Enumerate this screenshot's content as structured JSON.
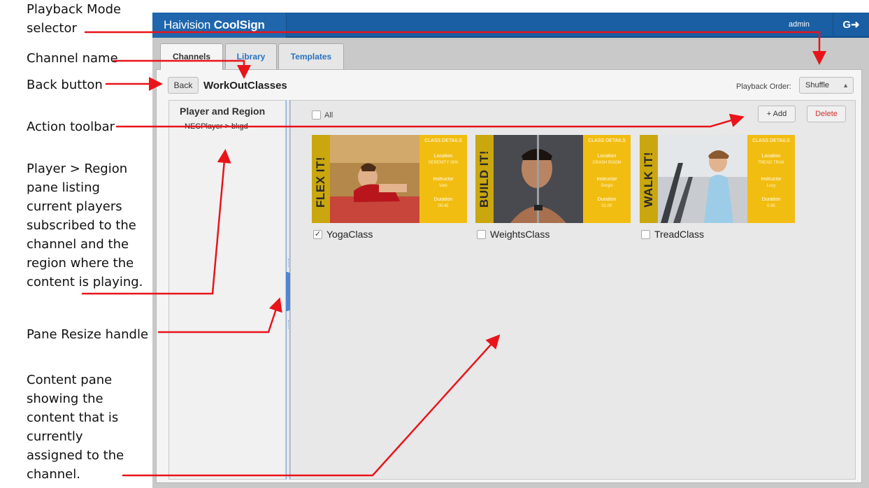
{
  "annotations": {
    "playback_mode": "Playback Mode\nselector",
    "channel_name": "Channel name",
    "back_button": "Back button",
    "action_toolbar": "Action toolbar",
    "player_region": "Player > Region pane listing current players subscribed to the channel and the region where the content is playing.",
    "pane_resize": "Pane Resize handle",
    "content_pane": "Content pane showing the content that is currently assigned to the channel."
  },
  "app": {
    "logo_light": "Hai",
    "logo_rest": "vision ",
    "logo_bold": "CoolSign",
    "user": "admin",
    "logout_icon": "logout-arrow-icon",
    "colors": {
      "topbar": "#1a5ea3",
      "link": "#2a72c0",
      "delete": "#d03030",
      "card_info": "#f2bd11",
      "arrow": "#e8141a"
    }
  },
  "tabs": [
    {
      "label": "Channels",
      "active": true
    },
    {
      "label": "Library",
      "active": false
    },
    {
      "label": "Templates",
      "active": false
    }
  ],
  "header": {
    "back_label": "Back",
    "channel_name": "WorkOutClasses",
    "playback_label": "Playback Order:",
    "playback_value": "Shuffle"
  },
  "left_pane": {
    "title": "Player and Region",
    "items": [
      "NECPlayer > bkgd"
    ]
  },
  "toolbar": {
    "all_label": "All",
    "add_label": "+ Add",
    "delete_label": "Delete"
  },
  "cards": [
    {
      "name": "YogaClass",
      "checked": true,
      "check_mark": "✓",
      "banner": "FLEX IT!",
      "details_title": "CLASS DETAILS",
      "location_label": "Location",
      "location": "SERENITY SPA",
      "instructor_label": "Instructor",
      "instructor": "Vani",
      "duration_label": "Duration",
      "duration": "00:45"
    },
    {
      "name": "WeightsClass",
      "checked": false,
      "check_mark": "",
      "banner": "BUILD IT!",
      "details_title": "CLASS DETAILS",
      "location_label": "Location",
      "location": "CRASH ROOM",
      "instructor_label": "Instructor",
      "instructor": "Sergio",
      "duration_label": "Duration",
      "duration": "01:00"
    },
    {
      "name": "TreadClass",
      "checked": false,
      "check_mark": "",
      "banner": "WALK IT!",
      "details_title": "CLASS DETAILS",
      "location_label": "Location",
      "location": "TREAD TRAK",
      "instructor_label": "Instructor",
      "instructor": "Lucy",
      "duration_label": "Duration",
      "duration": "0:45"
    }
  ]
}
